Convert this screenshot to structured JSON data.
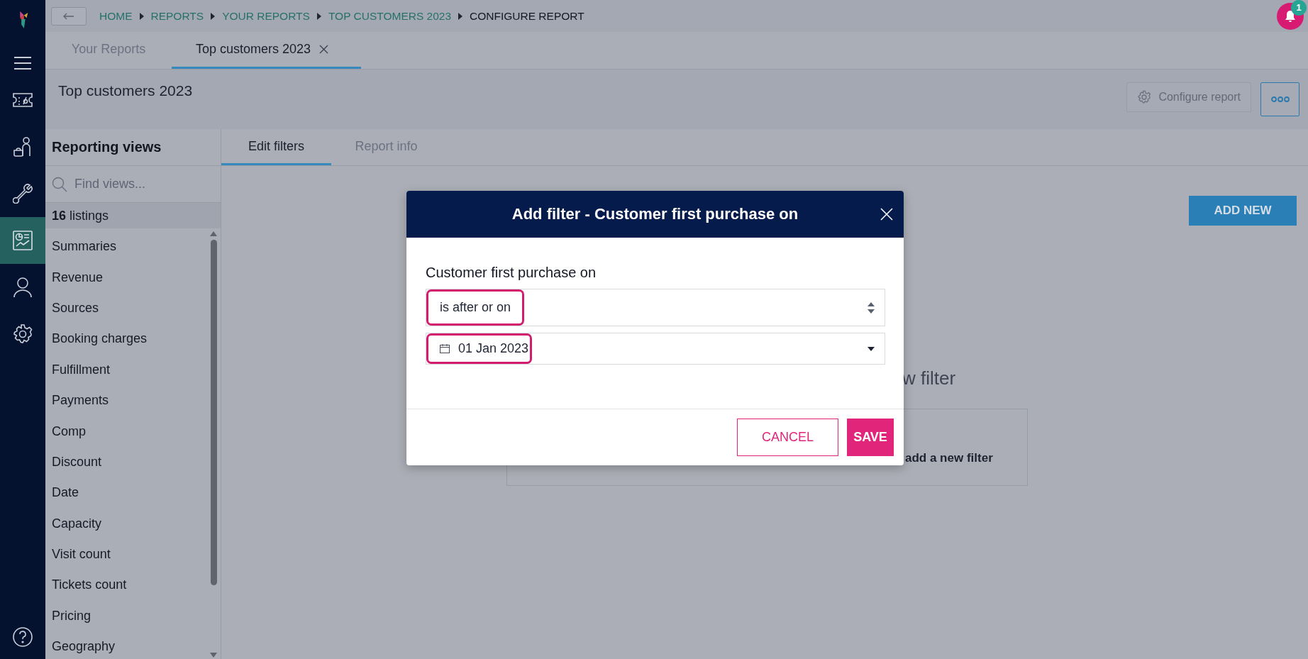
{
  "nav": {
    "items": [
      {
        "kind": "menu",
        "selected": false
      },
      {
        "kind": "ticket",
        "selected": false
      },
      {
        "kind": "visitor",
        "selected": false
      },
      {
        "kind": "wrench",
        "selected": false
      },
      {
        "kind": "report",
        "selected": true
      },
      {
        "kind": "person",
        "selected": false
      },
      {
        "kind": "gear",
        "selected": false
      }
    ]
  },
  "breadcrumbs": [
    {
      "label": "HOME",
      "current": false
    },
    {
      "label": "REPORTS",
      "current": false
    },
    {
      "label": "YOUR REPORTS",
      "current": false
    },
    {
      "label": "TOP CUSTOMERS 2023",
      "current": false
    },
    {
      "label": "CONFIGURE REPORT",
      "current": true
    }
  ],
  "notifications": {
    "count": "1"
  },
  "tabs": [
    {
      "label": "Your Reports",
      "selected": false,
      "closable": false
    },
    {
      "label": "Top customers 2023",
      "selected": true,
      "closable": true
    }
  ],
  "header": {
    "title": "Top customers 2023",
    "configure_button": "Configure report"
  },
  "sidebar": {
    "title": "Reporting views",
    "search": {
      "placeholder": "Find views..."
    },
    "listings": "**16** listings",
    "items": [
      "Summaries",
      "Revenue",
      "Sources",
      "Booking charges",
      "Fulfillment",
      "Payments",
      "Comp",
      "Discount",
      "Date",
      "Capacity",
      "Visit count",
      "Tickets count",
      "Pricing",
      "Geography"
    ]
  },
  "content_tabs": [
    {
      "label": "Edit filters",
      "selected": true
    },
    {
      "label": "Report info",
      "selected": false
    }
  ],
  "add_new_button": "ADD NEW",
  "background_heading": "w filter",
  "background_card_text": "add a new filter",
  "dialog": {
    "title": "Add filter - Customer first purchase on",
    "field_label": "Customer first purchase on",
    "fields": [
      {
        "kind": "select",
        "value": "is after or on",
        "highlighted": true
      },
      {
        "kind": "date",
        "value": "01 Jan 2023",
        "highlighted": true
      }
    ],
    "cancel": "CANCEL",
    "save": "SAVE"
  }
}
